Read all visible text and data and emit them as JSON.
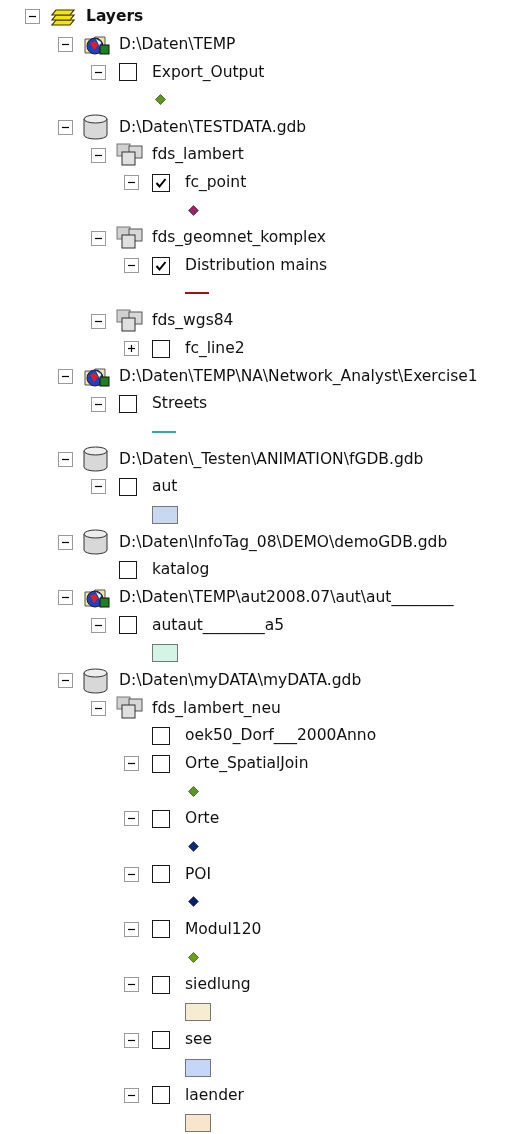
{
  "toc": {
    "kind": "group",
    "label": "Layers",
    "expanded": true,
    "children": [
      {
        "kind": "workspace",
        "label": "D:\\Daten\\TEMP",
        "expanded": true,
        "children": [
          {
            "kind": "layer",
            "label": "Export_Output",
            "expanded": true,
            "checked": false,
            "symbol": {
              "kind": "point",
              "color": "#5a9a1a"
            }
          }
        ]
      },
      {
        "kind": "geodatabase",
        "label": "D:\\Daten\\TESTDATA.gdb",
        "expanded": true,
        "children": [
          {
            "kind": "dataset",
            "label": "fds_lambert",
            "expanded": true,
            "children": [
              {
                "kind": "layer",
                "label": "fc_point",
                "expanded": true,
                "checked": true,
                "symbol": {
                  "kind": "point",
                  "color": "#a0206a"
                }
              }
            ]
          },
          {
            "kind": "dataset",
            "label": "fds_geomnet_komplex",
            "expanded": true,
            "children": [
              {
                "kind": "layer",
                "label": "Distribution mains",
                "expanded": true,
                "checked": true,
                "symbol": {
                  "kind": "line",
                  "color": "#a01020"
                }
              }
            ]
          },
          {
            "kind": "dataset",
            "label": "fds_wgs84",
            "expanded": true,
            "children": [
              {
                "kind": "layer",
                "label": "fc_line2",
                "expanded": false,
                "checked": false
              }
            ]
          }
        ]
      },
      {
        "kind": "workspace",
        "label": "D:\\Daten\\TEMP\\NA\\Network_Analyst\\Exercise1",
        "expanded": true,
        "children": [
          {
            "kind": "layer",
            "label": "Streets",
            "expanded": true,
            "checked": false,
            "symbol": {
              "kind": "line",
              "color": "#30a8a8"
            }
          }
        ]
      },
      {
        "kind": "geodatabase",
        "label": "D:\\Daten\\_Testen\\ANIMATION\\fGDB.gdb",
        "expanded": true,
        "children": [
          {
            "kind": "layer",
            "label": "aut",
            "expanded": true,
            "checked": false,
            "symbol": {
              "kind": "fill",
              "color": "#c8d8f0"
            }
          }
        ]
      },
      {
        "kind": "geodatabase",
        "label": "D:\\Daten\\InfoTag_08\\DEMO\\demoGDB.gdb",
        "expanded": true,
        "children": [
          {
            "kind": "layer",
            "label": "katalog",
            "checked": false
          }
        ]
      },
      {
        "kind": "workspace",
        "label": "D:\\Daten\\TEMP\\aut2008.07\\aut\\aut________",
        "expanded": true,
        "children": [
          {
            "kind": "layer",
            "label": "autaut________a5",
            "expanded": true,
            "checked": false,
            "symbol": {
              "kind": "fill",
              "color": "#d2f5e6"
            }
          }
        ]
      },
      {
        "kind": "geodatabase",
        "label": "D:\\Daten\\myDATA\\myDATA.gdb",
        "expanded": true,
        "children": [
          {
            "kind": "dataset",
            "label": "fds_lambert_neu",
            "expanded": true,
            "children": [
              {
                "kind": "layer",
                "label": "oek50_Dorf___2000Anno",
                "checked": false
              },
              {
                "kind": "layer",
                "label": "Orte_SpatialJoin",
                "expanded": true,
                "checked": false,
                "symbol": {
                  "kind": "point",
                  "color": "#5a9a1a"
                }
              },
              {
                "kind": "layer",
                "label": "Orte",
                "expanded": true,
                "checked": false,
                "symbol": {
                  "kind": "point",
                  "color": "#0c2a78"
                }
              },
              {
                "kind": "layer",
                "label": "POI",
                "expanded": true,
                "checked": false,
                "symbol": {
                  "kind": "point",
                  "color": "#0a1e6e"
                }
              },
              {
                "kind": "layer",
                "label": "Modul120",
                "expanded": true,
                "checked": false,
                "symbol": {
                  "kind": "point",
                  "color": "#6aa012"
                }
              },
              {
                "kind": "layer",
                "label": "siedlung",
                "expanded": true,
                "checked": false,
                "symbol": {
                  "kind": "fill",
                  "color": "#f6ecd0"
                }
              },
              {
                "kind": "layer",
                "label": "see",
                "expanded": true,
                "checked": false,
                "symbol": {
                  "kind": "fill",
                  "color": "#c6d6f8"
                }
              },
              {
                "kind": "layer",
                "label": "laender",
                "expanded": true,
                "checked": false,
                "symbol": {
                  "kind": "fill",
                  "color": "#f8e6cc"
                }
              }
            ]
          }
        ]
      }
    ]
  }
}
